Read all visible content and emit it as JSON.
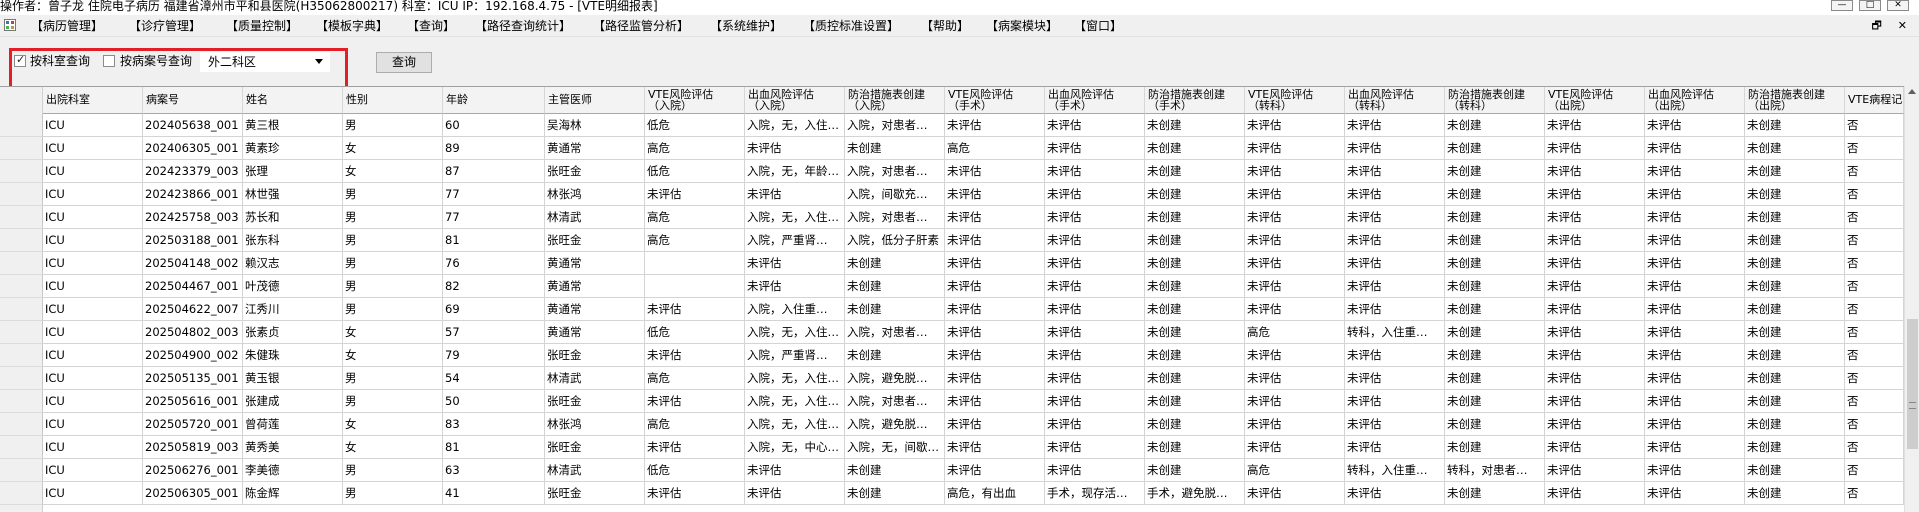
{
  "window": {
    "title": "操作者：曾子龙 住院电子病历 福建省漳州市平和县医院(H35062800217) 科室：ICU IP：192.168.4.75 - [VTE明细报表]",
    "minimize": "—",
    "maximize": "□",
    "close": "✕"
  },
  "menu": {
    "items": [
      "【病历管理】",
      "【诊疗管理】",
      "【质量控制】",
      "【模板字典】",
      "【查询】",
      "【路径查询统计】",
      "【路径监管分析】",
      "【系统维护】",
      "【质控标准设置】",
      "【帮助】",
      "【病案模块】",
      "【窗口】"
    ],
    "restore_icon": "🗗",
    "close_icon": "✕"
  },
  "filters": {
    "by_dept_label": "按科室查询",
    "by_dept_checked": true,
    "by_record_label": "按病案号查询",
    "by_record_checked": false,
    "dept_value": "外二科区",
    "query_button": "查询",
    "highlight_color": "#e41e26"
  },
  "table": {
    "columns": [
      "出院科室",
      "病案号",
      "姓名",
      "性别",
      "年龄",
      "主管医师",
      "VTE风险评估\n（入院）",
      "出血风险评估\n（入院）",
      "防治措施表创建\n（入院）",
      "VTE风险评估\n（手术）",
      "出血风险评估\n（手术）",
      "防治措施表创建\n（手术）",
      "VTE风险评估\n（转科）",
      "出血风险评估\n（转科）",
      "防治措施表创建\n（转科）",
      "VTE风险评估\n（出院）",
      "出血风险评估\n（出院）",
      "防治措施表创建\n（出院）",
      "VTE病程记"
    ],
    "rows": [
      [
        "ICU",
        "202405638_001",
        "黄三根",
        "男",
        "60",
        "吴海林",
        "低危",
        "入院，无，入住…",
        "入院，对患者…",
        "未评估",
        "未评估",
        "未创建",
        "未评估",
        "未评估",
        "未创建",
        "未评估",
        "未评估",
        "未创建",
        "否"
      ],
      [
        "ICU",
        "202406305_001",
        "黄素珍",
        "女",
        "89",
        "黄通常",
        "高危",
        "未评估",
        "未创建",
        "高危",
        "未评估",
        "未创建",
        "未评估",
        "未评估",
        "未创建",
        "未评估",
        "未评估",
        "未创建",
        "否"
      ],
      [
        "ICU",
        "202423379_003",
        "张理",
        "女",
        "87",
        "张旺金",
        "低危",
        "入院，无，年龄…",
        "入院，对患者…",
        "未评估",
        "未评估",
        "未创建",
        "未评估",
        "未评估",
        "未创建",
        "未评估",
        "未评估",
        "未创建",
        "否"
      ],
      [
        "ICU",
        "202423866_001",
        "林世强",
        "男",
        "77",
        "林张鸿",
        "未评估",
        "未评估",
        "入院，间歇充…",
        "未评估",
        "未评估",
        "未创建",
        "未评估",
        "未评估",
        "未创建",
        "未评估",
        "未评估",
        "未创建",
        "否"
      ],
      [
        "ICU",
        "202425758_003",
        "苏长和",
        "男",
        "77",
        "林清武",
        "高危",
        "入院，无，入住…",
        "入院，对患者…",
        "未评估",
        "未评估",
        "未创建",
        "未评估",
        "未评估",
        "未创建",
        "未评估",
        "未评估",
        "未创建",
        "否"
      ],
      [
        "ICU",
        "202503188_001",
        "张东科",
        "男",
        "81",
        "张旺金",
        "高危",
        "入院，严重肾…",
        "入院，低分子肝素",
        "未评估",
        "未评估",
        "未创建",
        "未评估",
        "未评估",
        "未创建",
        "未评估",
        "未评估",
        "未创建",
        "否"
      ],
      [
        "ICU",
        "202504148_002",
        "赖汉志",
        "男",
        "76",
        "黄通常",
        "",
        "未评估",
        "未创建",
        "未评估",
        "未评估",
        "未创建",
        "未评估",
        "未评估",
        "未创建",
        "未评估",
        "未评估",
        "未创建",
        "否"
      ],
      [
        "ICU",
        "202504467_001",
        "叶茂德",
        "男",
        "82",
        "黄通常",
        "",
        "未评估",
        "未创建",
        "未评估",
        "未评估",
        "未创建",
        "未评估",
        "未评估",
        "未创建",
        "未评估",
        "未评估",
        "未创建",
        "否"
      ],
      [
        "ICU",
        "202504622_007",
        "江秀川",
        "男",
        "69",
        "黄通常",
        "未评估",
        "入院，入住重…",
        "未创建",
        "未评估",
        "未评估",
        "未创建",
        "未评估",
        "未评估",
        "未创建",
        "未评估",
        "未评估",
        "未创建",
        "否"
      ],
      [
        "ICU",
        "202504802_003",
        "张素贞",
        "女",
        "57",
        "黄通常",
        "低危",
        "入院，无，入住…",
        "入院，对患者…",
        "未评估",
        "未评估",
        "未创建",
        "高危",
        "转科，入住重…",
        "未创建",
        "未评估",
        "未评估",
        "未创建",
        "否"
      ],
      [
        "ICU",
        "202504900_002",
        "朱健珠",
        "女",
        "79",
        "张旺金",
        "未评估",
        "入院，严重肾…",
        "未创建",
        "未评估",
        "未评估",
        "未创建",
        "未评估",
        "未评估",
        "未创建",
        "未评估",
        "未评估",
        "未创建",
        "否"
      ],
      [
        "ICU",
        "202505135_001",
        "黄玉银",
        "男",
        "54",
        "林清武",
        "高危",
        "入院，无，入住…",
        "入院，避免脱…",
        "未评估",
        "未评估",
        "未创建",
        "未评估",
        "未评估",
        "未创建",
        "未评估",
        "未评估",
        "未创建",
        "否"
      ],
      [
        "ICU",
        "202505616_001",
        "张建成",
        "男",
        "50",
        "张旺金",
        "未评估",
        "入院，无，入住…",
        "入院，对患者…",
        "未评估",
        "未评估",
        "未创建",
        "未评估",
        "未评估",
        "未创建",
        "未评估",
        "未评估",
        "未创建",
        "否"
      ],
      [
        "ICU",
        "202505720_001",
        "曾荷莲",
        "女",
        "83",
        "林张鸿",
        "高危",
        "入院，无，入住…",
        "入院，避免脱…",
        "未评估",
        "未评估",
        "未创建",
        "未评估",
        "未评估",
        "未创建",
        "未评估",
        "未评估",
        "未创建",
        "否"
      ],
      [
        "ICU",
        "202505819_003",
        "黄秀美",
        "女",
        "81",
        "张旺金",
        "未评估",
        "入院，无，中心…",
        "入院，无，间歇…",
        "未评估",
        "未评估",
        "未创建",
        "未评估",
        "未评估",
        "未创建",
        "未评估",
        "未评估",
        "未创建",
        "否"
      ],
      [
        "ICU",
        "202506276_001",
        "李美德",
        "男",
        "63",
        "林清武",
        "低危",
        "未评估",
        "未创建",
        "未评估",
        "未评估",
        "未创建",
        "高危",
        "转科，入住重…",
        "转科，对患者…",
        "未评估",
        "未评估",
        "未创建",
        "否"
      ],
      [
        "ICU",
        "202506305_001",
        "陈金辉",
        "男",
        "41",
        "张旺金",
        "未评估",
        "未评估",
        "未创建",
        "高危，有出血",
        "手术，现存活…",
        "手术，避免脱…",
        "未评估",
        "未评估",
        "未创建",
        "未评估",
        "未评估",
        "未创建",
        "否"
      ]
    ]
  }
}
